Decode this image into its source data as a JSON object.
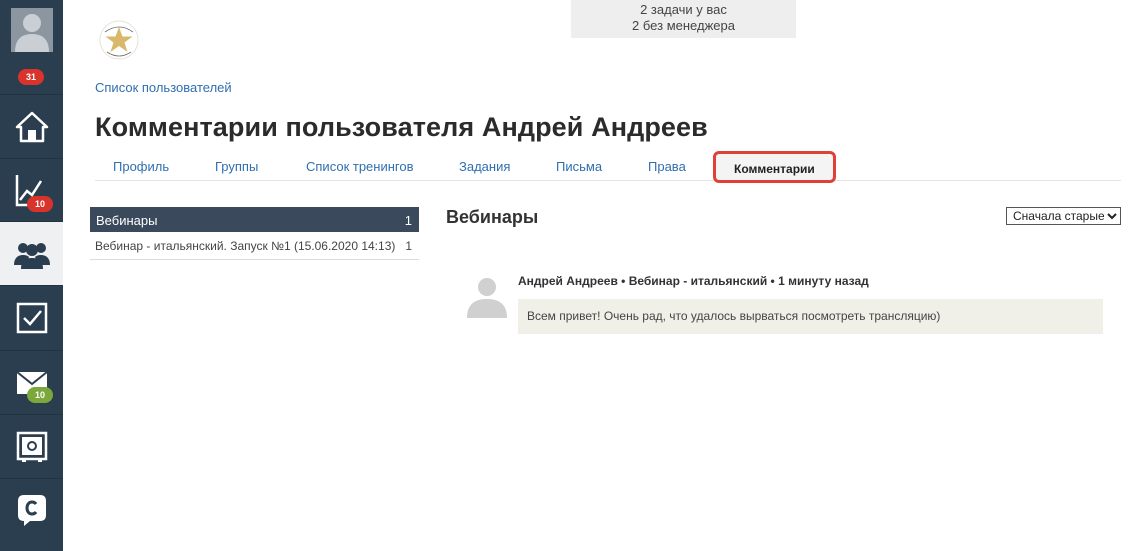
{
  "colors": {
    "sidebar": "#2b3e50",
    "link": "#2f6fb0",
    "active_tab_border": "#e0403a",
    "badge_red": "#d9342b",
    "badge_green": "#7aa83a",
    "list_header": "#3a4a5c",
    "comment_bg": "#f0f0e8"
  },
  "sidebar": {
    "items": [
      {
        "icon": "user-avatar-icon",
        "badge": "31",
        "badge_color": "red"
      },
      {
        "icon": "home-icon"
      },
      {
        "icon": "chart-icon",
        "badge": "10",
        "badge_color": "red"
      },
      {
        "icon": "users-icon",
        "active": true
      },
      {
        "icon": "checkbox-icon"
      },
      {
        "icon": "mail-icon",
        "badge": "10",
        "badge_color": "green"
      },
      {
        "icon": "safe-icon"
      },
      {
        "icon": "chat-icon"
      }
    ]
  },
  "top_notice": {
    "line1": "2 задачи у вас",
    "line2": "2 без менеджера"
  },
  "breadcrumb": "Список пользователей",
  "page_title": "Комментарии пользователя Андрей Андреев",
  "tabs": [
    {
      "label": "Профиль"
    },
    {
      "label": "Группы"
    },
    {
      "label": "Список тренингов"
    },
    {
      "label": "Задания"
    },
    {
      "label": "Письма"
    },
    {
      "label": "Права"
    },
    {
      "label": "Комментарии",
      "active": true
    }
  ],
  "list": {
    "header": {
      "name": "Вебинары",
      "count": "1"
    },
    "rows": [
      {
        "name": "Вебинар - итальянский. Запуск №1 (15.06.2020 14:13)",
        "count": "1"
      }
    ]
  },
  "section": {
    "title": "Вебинары",
    "sort_selected": "Сначала старые"
  },
  "comment": {
    "meta": "Андрей Андреев • Вебинар - итальянский • 1 минуту назад",
    "text": "Всем привет! Очень рад, что удалось вырваться посмотреть трансляцию)"
  }
}
